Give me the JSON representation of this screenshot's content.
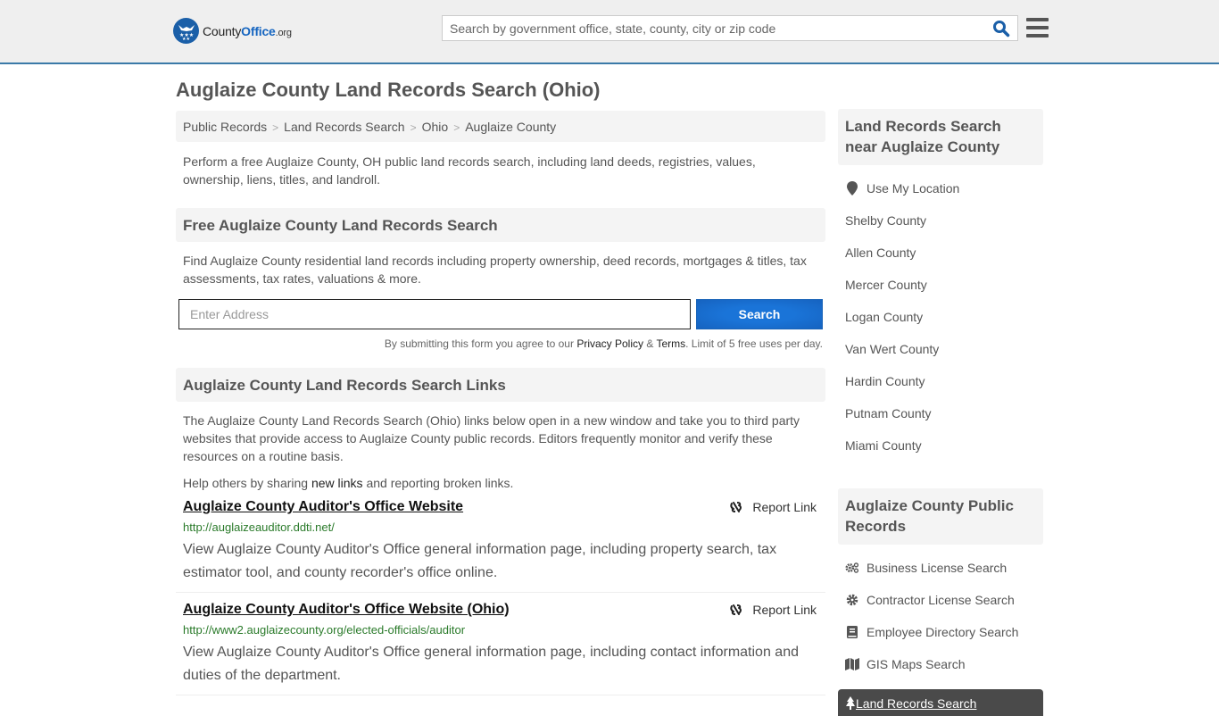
{
  "header": {
    "logo": {
      "county": "County",
      "office": "Office",
      "org": ".org"
    },
    "search_placeholder": "Search by government office, state, county, city or zip code",
    "brand_color": "#1565c0"
  },
  "page_title": "Auglaize County Land Records Search (Ohio)",
  "breadcrumb": [
    "Public Records",
    "Land Records Search",
    "Ohio",
    "Auglaize County"
  ],
  "intro": "Perform a free Auglaize County, OH public land records search, including land deeds, registries, values, ownership, liens, titles, and landroll.",
  "free_search": {
    "heading": "Free Auglaize County Land Records Search",
    "text": "Find Auglaize County residential land records including property ownership, deed records, mortgages & titles, tax assessments, tax rates, valuations & more.",
    "address_placeholder": "Enter Address",
    "button_label": "Search",
    "disclaimer_prefix": "By submitting this form you agree to our ",
    "privacy_label": "Privacy Policy",
    "amp": " & ",
    "terms_label": "Terms",
    "disclaimer_suffix": ". Limit of 5 free uses per day."
  },
  "links_section": {
    "heading": "Auglaize County Land Records Search Links",
    "text": "The Auglaize County Land Records Search (Ohio) links below open in a new window and take you to third party websites that provide access to Auglaize County public records. Editors frequently monitor and verify these resources on a routine basis.",
    "help_prefix": "Help others by sharing ",
    "help_link": "new links",
    "help_suffix": " and reporting broken links.",
    "report_label": "Report Link",
    "items": [
      {
        "title": "Auglaize County Auditor's Office Website",
        "url": "http://auglaizeauditor.ddti.net/",
        "description": "View Auglaize County Auditor's Office general information page, including property search, tax estimator tool, and county recorder's office online."
      },
      {
        "title": "Auglaize County Auditor's Office Website (Ohio)",
        "url": "http://www2.auglaizecounty.org/elected-officials/auditor",
        "description": "View Auglaize County Auditor's Office general information page, including contact information and duties of the department."
      }
    ]
  },
  "sidebar": {
    "nearby_heading": "Land Records Search near Auglaize County",
    "use_location": "Use My Location",
    "nearby": [
      "Shelby County",
      "Allen County",
      "Mercer County",
      "Logan County",
      "Van Wert County",
      "Hardin County",
      "Putnam County",
      "Miami County"
    ],
    "public_records_heading": "Auglaize County Public Records",
    "public_records": [
      {
        "label": "Business License Search",
        "icon": "gears-icon"
      },
      {
        "label": "Contractor License Search",
        "icon": "gear-icon"
      },
      {
        "label": "Employee Directory Search",
        "icon": "book-icon"
      },
      {
        "label": "GIS Maps Search",
        "icon": "map-icon"
      }
    ],
    "active_item": {
      "label": "Land Records Search",
      "icon": "tree-icon"
    }
  }
}
